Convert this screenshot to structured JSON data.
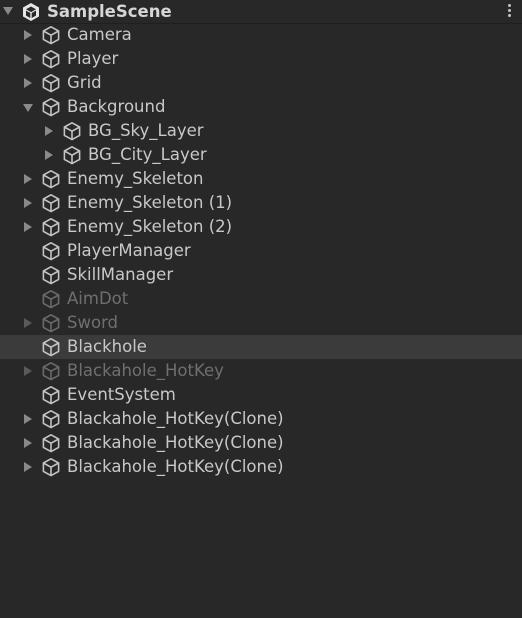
{
  "scene": {
    "title": "SampleScene",
    "menu_icon": "kebab-menu-icon",
    "logo_icon": "unity-logo-icon"
  },
  "colors": {
    "background": "#282828",
    "selected_row": "#3b3b3b",
    "text": "#c8c8c8",
    "text_inactive": "#6f6f6f"
  },
  "items": [
    {
      "label": "Camera",
      "depth": 0,
      "arrow": "collapsed",
      "active": true,
      "selected": false
    },
    {
      "label": "Player",
      "depth": 0,
      "arrow": "collapsed",
      "active": true,
      "selected": false
    },
    {
      "label": "Grid",
      "depth": 0,
      "arrow": "collapsed",
      "active": true,
      "selected": false
    },
    {
      "label": "Background",
      "depth": 0,
      "arrow": "expanded",
      "active": true,
      "selected": false
    },
    {
      "label": "BG_Sky_Layer",
      "depth": 1,
      "arrow": "collapsed",
      "active": true,
      "selected": false
    },
    {
      "label": "BG_City_Layer",
      "depth": 1,
      "arrow": "collapsed",
      "active": true,
      "selected": false
    },
    {
      "label": "Enemy_Skeleton",
      "depth": 0,
      "arrow": "collapsed",
      "active": true,
      "selected": false
    },
    {
      "label": "Enemy_Skeleton (1)",
      "depth": 0,
      "arrow": "collapsed",
      "active": true,
      "selected": false
    },
    {
      "label": "Enemy_Skeleton (2)",
      "depth": 0,
      "arrow": "collapsed",
      "active": true,
      "selected": false
    },
    {
      "label": "PlayerManager",
      "depth": 0,
      "arrow": "none",
      "active": true,
      "selected": false
    },
    {
      "label": "SkillManager",
      "depth": 0,
      "arrow": "none",
      "active": true,
      "selected": false
    },
    {
      "label": "AimDot",
      "depth": 0,
      "arrow": "none",
      "active": false,
      "selected": false
    },
    {
      "label": "Sword",
      "depth": 0,
      "arrow": "collapsed",
      "active": false,
      "selected": false
    },
    {
      "label": "Blackhole",
      "depth": 0,
      "arrow": "none",
      "active": true,
      "selected": true
    },
    {
      "label": "Blackahole_HotKey",
      "depth": 0,
      "arrow": "collapsed",
      "active": false,
      "selected": false
    },
    {
      "label": "EventSystem",
      "depth": 0,
      "arrow": "none",
      "active": true,
      "selected": false
    },
    {
      "label": "Blackahole_HotKey(Clone)",
      "depth": 0,
      "arrow": "collapsed",
      "active": true,
      "selected": false
    },
    {
      "label": "Blackahole_HotKey(Clone)",
      "depth": 0,
      "arrow": "collapsed",
      "active": true,
      "selected": false
    },
    {
      "label": "Blackahole_HotKey(Clone)",
      "depth": 0,
      "arrow": "collapsed",
      "active": true,
      "selected": false
    }
  ]
}
